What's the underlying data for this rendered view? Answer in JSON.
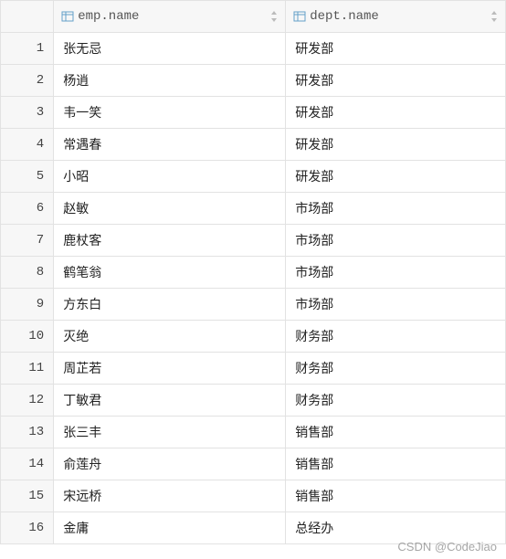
{
  "columns": {
    "emp": "emp.name",
    "dept": "dept.name"
  },
  "rows": [
    {
      "n": "1",
      "emp": "张无忌",
      "dept": "研发部"
    },
    {
      "n": "2",
      "emp": "杨逍",
      "dept": "研发部"
    },
    {
      "n": "3",
      "emp": "韦一笑",
      "dept": "研发部"
    },
    {
      "n": "4",
      "emp": "常遇春",
      "dept": "研发部"
    },
    {
      "n": "5",
      "emp": "小昭",
      "dept": "研发部"
    },
    {
      "n": "6",
      "emp": "赵敏",
      "dept": "市场部"
    },
    {
      "n": "7",
      "emp": "鹿杖客",
      "dept": "市场部"
    },
    {
      "n": "8",
      "emp": "鹤笔翁",
      "dept": "市场部"
    },
    {
      "n": "9",
      "emp": "方东白",
      "dept": "市场部"
    },
    {
      "n": "10",
      "emp": "灭绝",
      "dept": "财务部"
    },
    {
      "n": "11",
      "emp": "周芷若",
      "dept": "财务部"
    },
    {
      "n": "12",
      "emp": "丁敏君",
      "dept": "财务部"
    },
    {
      "n": "13",
      "emp": "张三丰",
      "dept": "销售部"
    },
    {
      "n": "14",
      "emp": "俞莲舟",
      "dept": "销售部"
    },
    {
      "n": "15",
      "emp": "宋远桥",
      "dept": "销售部"
    },
    {
      "n": "16",
      "emp": "金庸",
      "dept": "总经办"
    }
  ],
  "watermark": "CSDN @CodeJiao"
}
